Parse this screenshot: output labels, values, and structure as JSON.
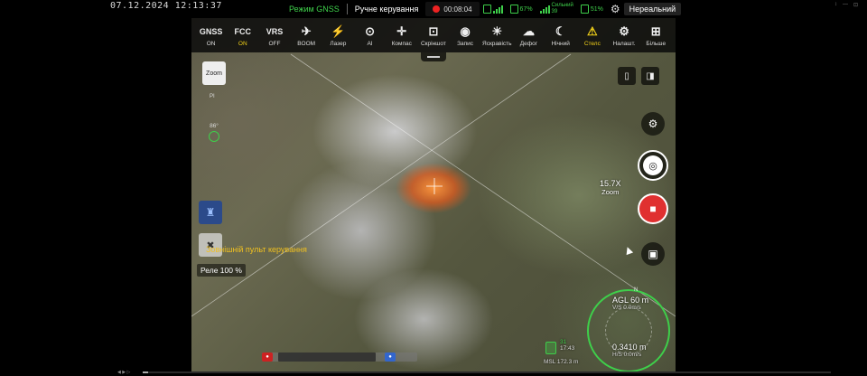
{
  "top": {
    "timestamp": "07.12.2024 12:13:37",
    "flight_mode": "Режим GNSS",
    "control_mode": "Ручне керування",
    "rec_time": "00:08:04",
    "aircraft_battery": "67%",
    "signal_label": "Сильний",
    "signal_value": "39",
    "rc_battery": "51%",
    "view_mode": "Нереальний",
    "corner_ctrls": [
      "↕",
      "—",
      "⊡"
    ]
  },
  "toolbar": {
    "items": [
      {
        "icon": "GNSS",
        "label": "ON",
        "active": false,
        "label_on": false
      },
      {
        "icon": "FCC",
        "label": "ON",
        "active": false,
        "label_on": true
      },
      {
        "icon": "VRS",
        "label": "OFF",
        "active": false,
        "label_on": false
      },
      {
        "icon": "✈",
        "label": "BOOM",
        "active": false,
        "label_on": false
      },
      {
        "icon": "⚡",
        "label": "Лазер",
        "active": false,
        "label_on": false
      },
      {
        "icon": "⊙",
        "label": "AI",
        "active": false,
        "label_on": false
      },
      {
        "icon": "✛",
        "label": "Компас",
        "active": false,
        "label_on": false
      },
      {
        "icon": "⊡",
        "label": "Скріншот",
        "active": false,
        "label_on": false
      },
      {
        "icon": "◉",
        "label": "Запис",
        "active": false,
        "label_on": false
      },
      {
        "icon": "☀",
        "label": "Яскравість",
        "active": false,
        "label_on": false
      },
      {
        "icon": "☁",
        "label": "Дефог",
        "active": false,
        "label_on": false
      },
      {
        "icon": "☾",
        "label": "Нічний",
        "active": false,
        "label_on": false
      },
      {
        "icon": "⚠",
        "label": "Стелс",
        "active": true,
        "label_on": false
      },
      {
        "icon": "⚙",
        "label": "Налашт.",
        "active": false,
        "label_on": false
      },
      {
        "icon": "⊞",
        "label": "Більше",
        "active": false,
        "label_on": false
      }
    ]
  },
  "left": {
    "zoom_btn": "Zoom",
    "small_label": "PI",
    "gimbal_angle": "86°",
    "rc_text": "Зовнішній пульт керування",
    "relay": "Реле 100 %"
  },
  "right": {
    "zoom_value": "15.7X",
    "zoom_label": "Zoom"
  },
  "telemetry": {
    "agl": "AGL 60 m",
    "vs": "V/S 0.0m/s",
    "distance": "0.3410 m",
    "hs": "H/S 0.0m/s",
    "msl": "MSL 172.3 m",
    "batt_value": "17:43",
    "gps_count": "31",
    "north": "N"
  },
  "colors": {
    "accent_yellow": "#f3d21a",
    "status_green": "#3ecf4a",
    "record_red": "#e03030"
  }
}
